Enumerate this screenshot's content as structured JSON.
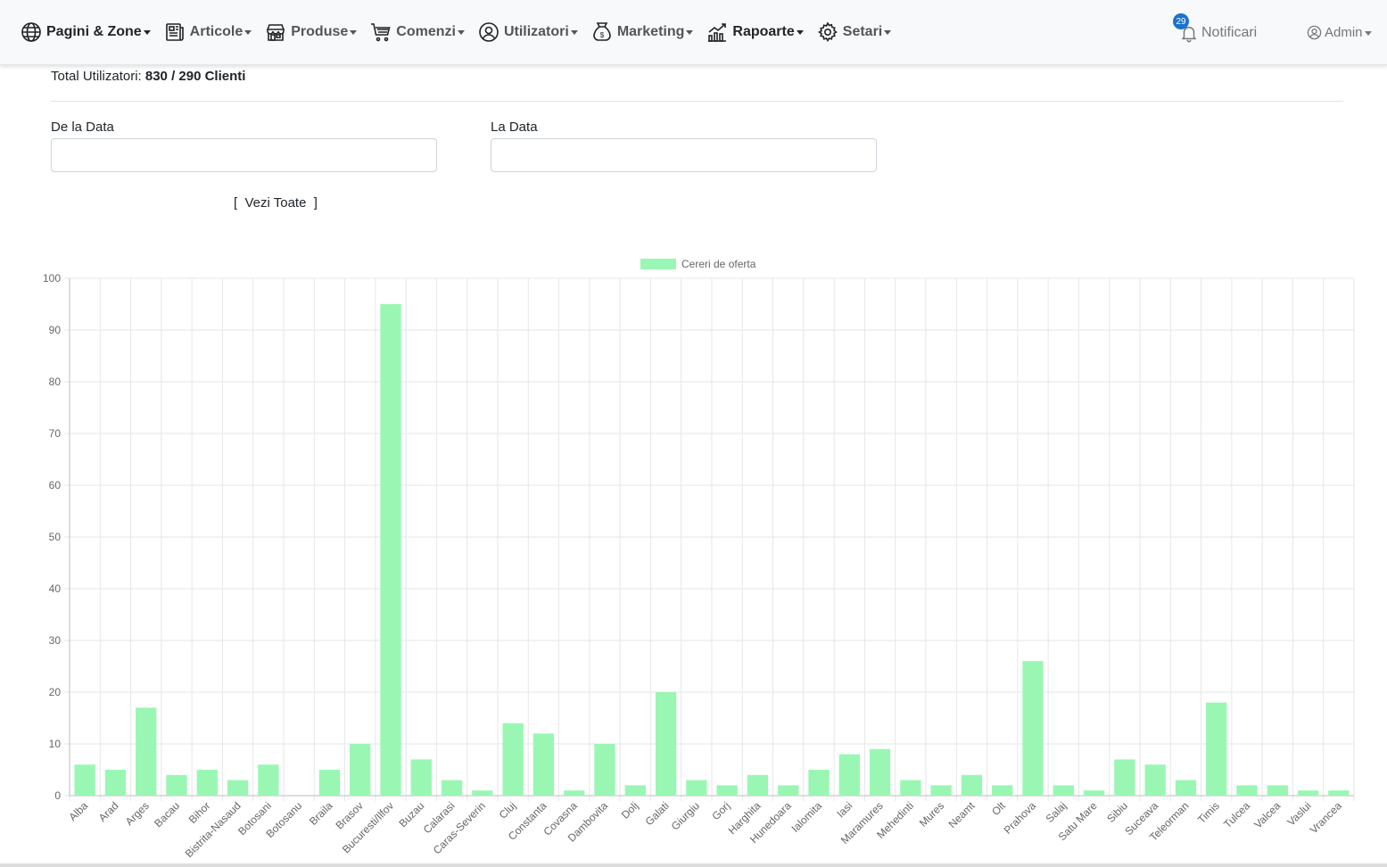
{
  "nav": {
    "items": [
      {
        "label": "Pagini & Zone",
        "icon": "globe-icon",
        "bold": true
      },
      {
        "label": "Articole",
        "icon": "newspaper-icon",
        "bold": false
      },
      {
        "label": "Produse",
        "icon": "shop-icon",
        "bold": false
      },
      {
        "label": "Comenzi",
        "icon": "cart-icon",
        "bold": false
      },
      {
        "label": "Utilizatori",
        "icon": "user-circle-icon",
        "bold": false
      },
      {
        "label": "Marketing",
        "icon": "money-bag-icon",
        "bold": false
      },
      {
        "label": "Rapoarte",
        "icon": "chart-growth-icon",
        "bold": true
      },
      {
        "label": "Setari",
        "icon": "gear-icon",
        "bold": false
      }
    ],
    "notifications": {
      "label": "Notificari",
      "count": "29"
    },
    "admin": {
      "label": "Admin"
    }
  },
  "summary": {
    "prefix": "Total Utilizatori: ",
    "value": "830 / 290 Clienti"
  },
  "filters": {
    "from_label": "De la Data",
    "to_label": "La Data",
    "from_value": "",
    "to_value": "",
    "view_all": "[  Vezi Toate  ]"
  },
  "chart_data": {
    "type": "bar",
    "legend": "Cereri de oferta",
    "legend_position": "top-center",
    "color": "#99f7b3",
    "grid": true,
    "ylim": [
      0,
      100
    ],
    "yticks": [
      0,
      10,
      20,
      30,
      40,
      50,
      60,
      70,
      80,
      90,
      100
    ],
    "categories": [
      "Alba",
      "Arad",
      "Arges",
      "Bacau",
      "Bihor",
      "Bistrita-Nasaud",
      "Botosani",
      "Botosanu",
      "Braila",
      "Brasov",
      "Bucuresti/Ilfov",
      "Buzau",
      "Calarasi",
      "Caras-Severin",
      "Cluj",
      "Constanta",
      "Covasna",
      "Dambovita",
      "Dolj",
      "Galati",
      "Giurgiu",
      "Gorj",
      "Harghita",
      "Hunedoara",
      "Ialomita",
      "Iasi",
      "Maramures",
      "Mehedinti",
      "Mures",
      "Neamt",
      "Olt",
      "Prahova",
      "Salaj",
      "Satu Mare",
      "Sibiu",
      "Suceava",
      "Teleorman",
      "Timis",
      "Tulcea",
      "Valcea",
      "Vaslui",
      "Vrancea"
    ],
    "values": [
      6,
      5,
      17,
      4,
      5,
      3,
      6,
      0,
      5,
      10,
      95,
      7,
      3,
      1,
      14,
      12,
      1,
      10,
      2,
      20,
      3,
      2,
      4,
      2,
      5,
      8,
      9,
      3,
      2,
      4,
      2,
      26,
      2,
      1,
      7,
      6,
      3,
      18,
      2,
      2,
      1,
      1
    ]
  }
}
